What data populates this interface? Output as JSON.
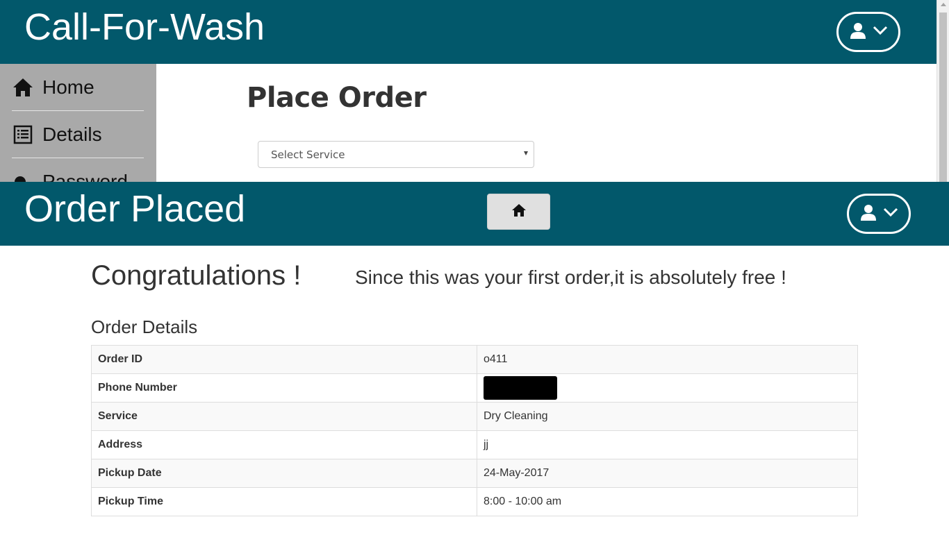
{
  "background": {
    "app_title": "Call-For-Wash",
    "sidebar": {
      "items": [
        {
          "label": "Home",
          "icon": "home-icon"
        },
        {
          "label": "Details",
          "icon": "list-icon"
        },
        {
          "label": "Password",
          "icon": "key-icon"
        }
      ]
    },
    "main": {
      "title": "Place Order",
      "service_select": {
        "selected": "Select Service"
      }
    }
  },
  "header": {
    "title": "Order Placed",
    "home_button_icon": "home-icon",
    "user_menu_icons": [
      "user-icon",
      "chevron-down-icon"
    ]
  },
  "content": {
    "congrats": "Congratulations !",
    "message": "Since this was your first order,it is absolutely free !",
    "details_heading": "Order Details",
    "rows": [
      {
        "label": "Order ID",
        "value": "o411"
      },
      {
        "label": "Phone Number",
        "value": ""
      },
      {
        "label": "Service",
        "value": "Dry Cleaning"
      },
      {
        "label": "Address",
        "value": "jj"
      },
      {
        "label": "Pickup Date",
        "value": "24-May-2017"
      },
      {
        "label": "Pickup Time",
        "value": "8:00 - 10:00 am"
      }
    ]
  },
  "colors": {
    "header_bg": "#02586b",
    "sidebar_bg": "#a9a9a9",
    "home_button_bg": "#e0e0e0"
  }
}
